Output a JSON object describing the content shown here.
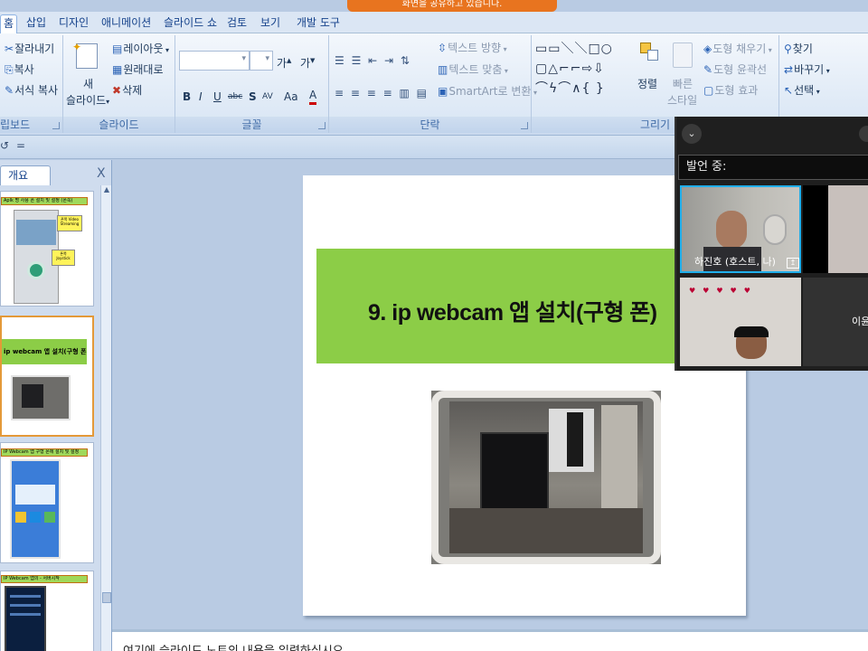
{
  "share_banner": "화면을 공유하고 있습니다.",
  "menu": {
    "tabs": [
      "홈",
      "삽입",
      "디자인",
      "애니메이션",
      "슬라이드 쇼",
      "검토",
      "보기",
      "개발 도구"
    ]
  },
  "ribbon": {
    "clipboard": {
      "cut": "잘라내기",
      "copy": "복사",
      "format_painter": "서식 복사",
      "title": "립보드"
    },
    "slides": {
      "new_slide_line1": "새",
      "new_slide_line2": "슬라이드",
      "layout": "레이아웃",
      "reset": "원래대로",
      "delete": "삭제",
      "title": "슬라이드"
    },
    "font": {
      "title": "글꼴",
      "bold": "B",
      "italic": "I",
      "underline": "U",
      "strike": "abc",
      "shadow": "S",
      "spacing": "AV",
      "case": "Aa",
      "color": "A",
      "grow": "가",
      "shrink": "가"
    },
    "paragraph": {
      "text_direction": "텍스트 방향",
      "align_text": "텍스트 맞춤",
      "smartart": "SmartArt로 변환",
      "title": "단락"
    },
    "drawing": {
      "arrange": "정렬",
      "quick_styles_line1": "빠른",
      "quick_styles_line2": "스타일",
      "shape_fill": "도형 채우기",
      "shape_outline": "도형 윤곽선",
      "shape_effects": "도형 효과",
      "title": "그리기"
    },
    "editing": {
      "find": "찾기",
      "replace": "바꾸기",
      "select": "선택"
    }
  },
  "panel": {
    "tab_label": "개요",
    "close_label": "X",
    "thumbs": [
      {
        "title": "Aplk 명 사용 폰 설치 및 설정 (폰쪽)",
        "callout1": "폰쪽 Video Streaming",
        "callout2": "폰쪽 Joystick"
      },
      {
        "title": "ip webcam 앱 설치(구형 폰)"
      },
      {
        "title": "IP Webcam 앱 구형 폰에 설치 및 설정"
      },
      {
        "title": "IP Webcam 앱의 - 서버시작"
      }
    ]
  },
  "slide": {
    "title": "9.  ip webcam 앱 설치(구형 폰)"
  },
  "notes_placeholder": "여기에 슬라이드 노트의 내용을 입력하십시오.",
  "zoom": {
    "speaking_label": "발언 중:",
    "host_name": "하진호 (호스트, 나)",
    "other_name": "이윤"
  }
}
